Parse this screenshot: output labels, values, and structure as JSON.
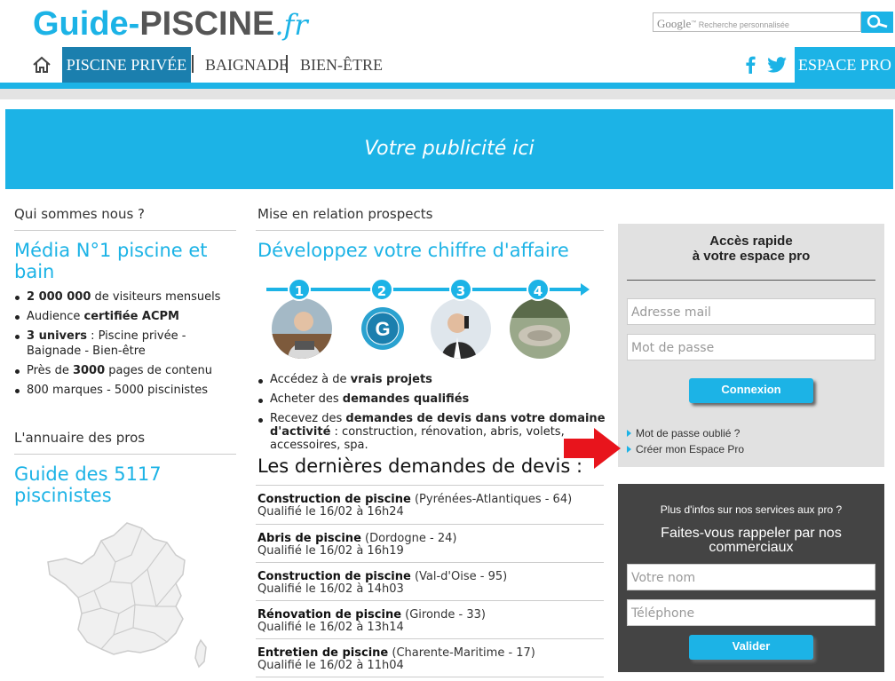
{
  "header": {
    "logo_part1": "Guide-",
    "logo_part2": "PISCINE",
    "logo_part3": ".fr",
    "search_brand": "Google",
    "search_brand_tm": "™",
    "search_placeholder": "Recherche personnalisée",
    "nav": [
      "PISCINE PRIVÉE",
      "BAIGNADE",
      "BIEN-ÊTRE"
    ],
    "espace_pro": "ESPACE PRO"
  },
  "ad": {
    "text": "Votre publicité ici"
  },
  "left": {
    "about_title": "Qui sommes nous ?",
    "media_title": "Média N°1 piscine et bain",
    "bullets": [
      {
        "b": "2 000 000",
        "t": " de visiteurs mensuels",
        "pre": ""
      },
      {
        "pre": "Audience ",
        "b": "certifiée ACPM",
        "t": ""
      },
      {
        "b": "3 univers",
        "t": " : Piscine privée - Baignade - Bien-être",
        "pre": ""
      },
      {
        "pre": "Près de ",
        "b": "3000",
        "t": " pages de contenu"
      },
      {
        "pre": "800 marques - 5000 piscinistes",
        "b": "",
        "t": ""
      }
    ],
    "annuaire_title": "L'annuaire des pros",
    "guide_title": "Guide des 5117 piscinistes"
  },
  "middle": {
    "section_title": "Mise en relation prospects",
    "headline": "Développez votre chiffre d'affaire",
    "steps": [
      "1",
      "2",
      "3",
      "4"
    ],
    "bullets": [
      {
        "pre": "Accédez à de ",
        "b": "vrais projets",
        "t": ""
      },
      {
        "pre": "Acheter des ",
        "b": "demandes qualifiés",
        "t": ""
      },
      {
        "pre": "Recevez des ",
        "b": "demandes de devis dans votre domaine d'activité",
        "t": " : construction, rénovation, abris, volets, accessoires, spa."
      }
    ],
    "requests_title": "Les dernières demandes de devis :",
    "requests": [
      {
        "title": "Construction de piscine",
        "place": " (Pyrénées-Atlantiques - 64)",
        "date": "Qualifié le 16/02 à 16h24"
      },
      {
        "title": "Abris de piscine",
        "place": " (Dordogne - 24)",
        "date": "Qualifié le 16/02 à 16h19"
      },
      {
        "title": "Construction de piscine",
        "place": " (Val-d'Oise - 95)",
        "date": "Qualifié le 16/02 à 14h03"
      },
      {
        "title": "Rénovation de piscine",
        "place": " (Gironde - 33)",
        "date": "Qualifié le 16/02 à 13h14"
      },
      {
        "title": "Entretien de piscine",
        "place": " (Charente-Maritime - 17)",
        "date": "Qualifié le 16/02 à 11h04"
      }
    ]
  },
  "login": {
    "title_line1": "Accès rapide",
    "title_line2": "à votre espace pro",
    "email_placeholder": "Adresse mail",
    "password_placeholder": "Mot de passe",
    "submit": "Connexion",
    "forgot": "Mot de passe oublié ?",
    "create": "Créer mon Espace Pro"
  },
  "callback": {
    "intro": "Plus d'infos sur nos services aux pro ?",
    "headline": "Faites-vous rappeler par nos commerciaux",
    "name_placeholder": "Votre nom",
    "phone_placeholder": "Téléphone",
    "submit": "Valider"
  },
  "colors": {
    "accent": "#1cb3e6",
    "nav_active": "#1b7fae",
    "arrow": "#e8141c"
  }
}
